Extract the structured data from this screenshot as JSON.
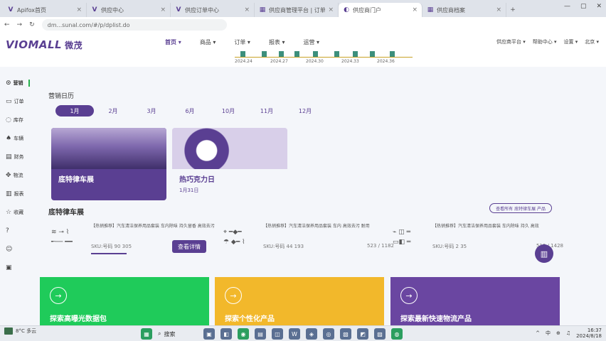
{
  "browser": {
    "tabs": [
      {
        "icon": "V",
        "title": "Apifox首页",
        "active": false
      },
      {
        "icon": "V",
        "title": "供应中心",
        "active": false
      },
      {
        "icon": "V",
        "title": "供应订单中心",
        "active": false
      },
      {
        "icon": "▦",
        "title": "供应商管理平台 | 订单",
        "active": false
      },
      {
        "icon": "◐",
        "title": "供应商门户",
        "active": true
      },
      {
        "icon": "▦",
        "title": "供应商档案",
        "active": false
      }
    ],
    "new_tab": "+",
    "url": "dm...sunal.com/#/p/dplist.do"
  },
  "app": {
    "logo": "VIOMALL",
    "logo_cn": "微茂",
    "menu": [
      {
        "label": "首页 ▾",
        "active": true
      },
      {
        "label": "商品 ▾",
        "active": false
      },
      {
        "label": "订单 ▾",
        "active": false
      },
      {
        "label": "报表 ▾",
        "active": false
      },
      {
        "label": "运营 ▾",
        "active": false
      }
    ],
    "timeline_labels": [
      "2024.24",
      "2024.27",
      "2024.30",
      "2024.33",
      "2024.36"
    ],
    "user_items": [
      "供应商平台 ▾",
      "帮助中心 ▾",
      "设置 ▾",
      "北京 ▾"
    ]
  },
  "sidebar": {
    "items": [
      {
        "icon": "⊙",
        "label": "营销"
      },
      {
        "icon": "▭",
        "label": "订单"
      },
      {
        "icon": "◌",
        "label": "库存"
      },
      {
        "icon": "♠",
        "label": "车辆"
      },
      {
        "icon": "▤",
        "label": "财务"
      },
      {
        "icon": "✥",
        "label": "物流"
      },
      {
        "icon": "▥",
        "label": "报表"
      },
      {
        "icon": "☆",
        "label": "收藏"
      },
      {
        "icon": "?",
        "label": ""
      },
      {
        "icon": "☺",
        "label": ""
      },
      {
        "icon": "▣",
        "label": ""
      }
    ]
  },
  "calendar": {
    "title": "营销日历",
    "months": [
      "1月",
      "2月",
      "3月",
      "6月",
      "10月",
      "11月",
      "12月"
    ],
    "selected": "1月"
  },
  "cards": [
    {
      "title": "底特律车展",
      "date": ""
    },
    {
      "title": "热巧克力日",
      "date": "1月31日"
    }
  ],
  "section": {
    "title": "底特律车展",
    "more": "查看所有 底特律车展 产品"
  },
  "products": [
    {
      "desc": "【热销推荐】汽车清洁保养用品套装 车内除味 持久留香 高效去污",
      "sku": "SKU:号码 90 305",
      "button": "查看详情",
      "price": ""
    },
    {
      "desc": "【热销推荐】汽车清洁保养用品套装 车内 高效去污 耐用",
      "sku": "SKU:号码 44 193",
      "button": "",
      "price": "523 / 1182"
    },
    {
      "desc": "【热销推荐】汽车清洁保养用品套装 车内除味 持久 高效",
      "sku": "SKU:号码 2 35",
      "button": "",
      "price": "510 / 1428"
    }
  ],
  "fab_icon": "book-icon",
  "banners": [
    {
      "title": "探索高曝光数据包",
      "color": "#1fcb5a"
    },
    {
      "title": "探索个性化产品",
      "color": "#f2b82b"
    },
    {
      "title": "探索最新快速物流产品",
      "color": "#6a46a1"
    }
  ],
  "taskbar": {
    "weather": "8°C 多云",
    "search": "搜索",
    "tray": [
      "^",
      "中",
      "⊕",
      "♫"
    ],
    "time": "16:37",
    "date": "2024/8/18"
  }
}
